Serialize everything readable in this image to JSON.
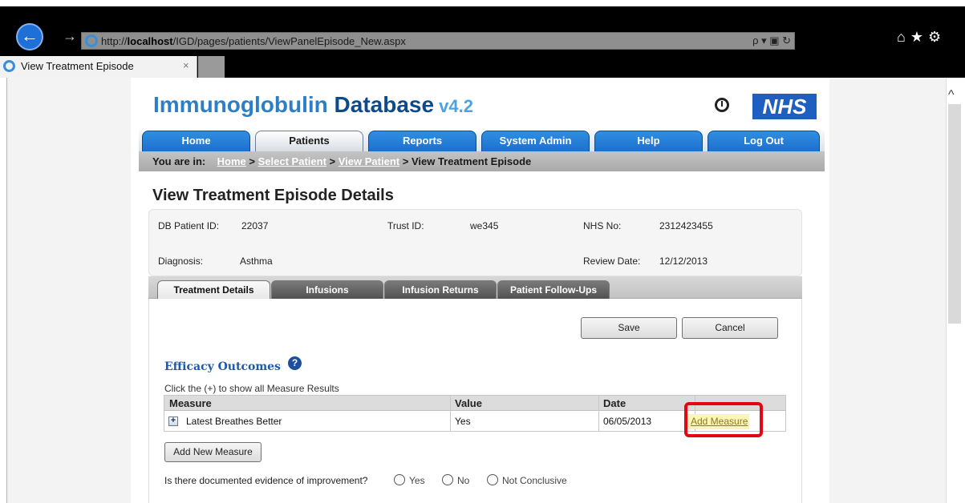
{
  "browser": {
    "url_prefix": "http://",
    "url_host": "localhost",
    "url_path": "/IGD/pages/patients/ViewPanelEpisode_New.aspx",
    "address_tools": "ρ ▾ ▣ ↻",
    "right_icons": "⌂★⚙",
    "tab_title": "View Treatment Episode",
    "tab_close": "×",
    "back_symbol": "←",
    "forward_symbol": "→"
  },
  "header": {
    "logo_part1": "Immunoglobulin ",
    "logo_part2": "Database",
    "logo_version": " v4.2",
    "nhs_logo": "NHS",
    "icons": [
      "clock-icon",
      "nhs-logo"
    ]
  },
  "nav": {
    "items": [
      {
        "label": "Home",
        "active": false
      },
      {
        "label": "Patients",
        "active": true
      },
      {
        "label": "Reports",
        "active": false
      },
      {
        "label": "System Admin",
        "active": false
      },
      {
        "label": "Help",
        "active": false
      },
      {
        "label": "Log Out",
        "active": false
      }
    ]
  },
  "breadcrumb": {
    "prefix": "You are in:",
    "links": [
      "Home",
      "Select Patient",
      "View Patient"
    ],
    "separator": ">",
    "current": "View Treatment Episode"
  },
  "page_title": "View Treatment Episode Details",
  "patient": {
    "db_patient_id_label": "DB Patient ID:",
    "db_patient_id": "22037",
    "trust_id_label": "Trust ID:",
    "trust_id": "we345",
    "nhs_no_label": "NHS No:",
    "nhs_no": "2312423455",
    "diagnosis_label": "Diagnosis:",
    "diagnosis": "Asthma",
    "review_date_label": "Review Date:",
    "review_date": "12/12/2013"
  },
  "subtabs": [
    {
      "label": "Treatment Details",
      "active": true
    },
    {
      "label": "Infusions",
      "active": false
    },
    {
      "label": "Infusion Returns",
      "active": false
    },
    {
      "label": "Patient Follow-Ups",
      "active": false
    }
  ],
  "actions": {
    "save": "Save",
    "cancel": "Cancel"
  },
  "efficacy": {
    "title": "Efficacy Outcomes",
    "help_symbol": "?",
    "hint": "Click the (+) to show all Measure Results",
    "columns": [
      "Measure",
      "Value",
      "Date"
    ],
    "rows": [
      {
        "expand": "+",
        "measure": "Latest Breathes Better",
        "value": "Yes",
        "date": "06/05/2013",
        "action": "Add Measure"
      }
    ],
    "add_new_button": "Add New Measure"
  },
  "improvement": {
    "question": "Is there documented evidence of improvement?",
    "options": [
      "Yes",
      "No",
      "Not Conclusive"
    ]
  },
  "colors": {
    "nav_blue": "#1e6fcf",
    "logo_dark": "#0c4a8c",
    "logo_light": "#2c7fc7",
    "section_title": "#1e5aa8",
    "highlight": "#e30613",
    "add_measure_bg": "#fbf6b8"
  }
}
